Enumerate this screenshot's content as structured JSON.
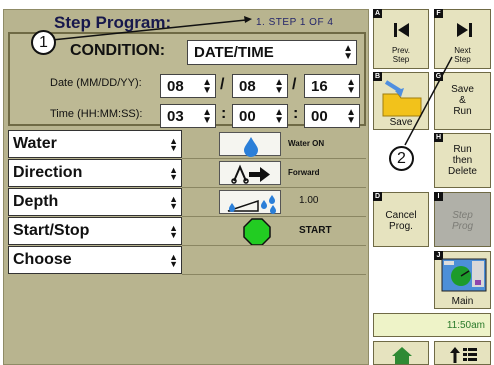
{
  "header": {
    "title": "Step Program:",
    "step_info": "1. STEP  1  OF  4"
  },
  "condition": {
    "label": "CONDITION:",
    "value": "DATE/TIME",
    "date_label": "Date (MM/DD/YY):",
    "date": [
      "08",
      "08",
      "16"
    ],
    "date_sep": "/",
    "time_label": "Time (HH:MM:SS):",
    "time": [
      "03",
      "00",
      "00"
    ],
    "time_sep": ":"
  },
  "rows": [
    {
      "name": "Water",
      "icon": "water-drop-icon",
      "status": "Water ON"
    },
    {
      "name": "Direction",
      "icon": "direction-icon",
      "status": "Forward"
    },
    {
      "name": "Depth",
      "icon": "depth-icon",
      "status": "1.00"
    },
    {
      "name": "Start/Stop",
      "icon": "start-stop-icon",
      "status": "START"
    },
    {
      "name": "Choose",
      "icon": "",
      "status": ""
    }
  ],
  "buttons": {
    "A": {
      "letter": "A",
      "label_1": "Prev.",
      "label_2": "Step"
    },
    "F": {
      "letter": "F",
      "label_1": "Next",
      "label_2": "Step"
    },
    "B": {
      "letter": "B",
      "label": "Save"
    },
    "G": {
      "letter": "G",
      "label_1": "Save",
      "label_2": "&",
      "label_3": "Run"
    },
    "H": {
      "letter": "H",
      "label_1": "Run",
      "label_2": "then",
      "label_3": "Delete"
    },
    "D": {
      "letter": "D",
      "label_1": "Cancel",
      "label_2": "Prog."
    },
    "I": {
      "letter": "I",
      "label_1": "Step",
      "label_2": "Prog"
    },
    "J": {
      "letter": "J",
      "label": "Main"
    }
  },
  "clock": "11:50am",
  "callouts": {
    "one": "1",
    "two": "2"
  },
  "colors": {
    "panel": "#b8b48f",
    "button_light": "#e6e3bf",
    "clock_bg": "#eef3c8",
    "clock_text": "#2a7a2a",
    "start_green": "#22cc22"
  }
}
